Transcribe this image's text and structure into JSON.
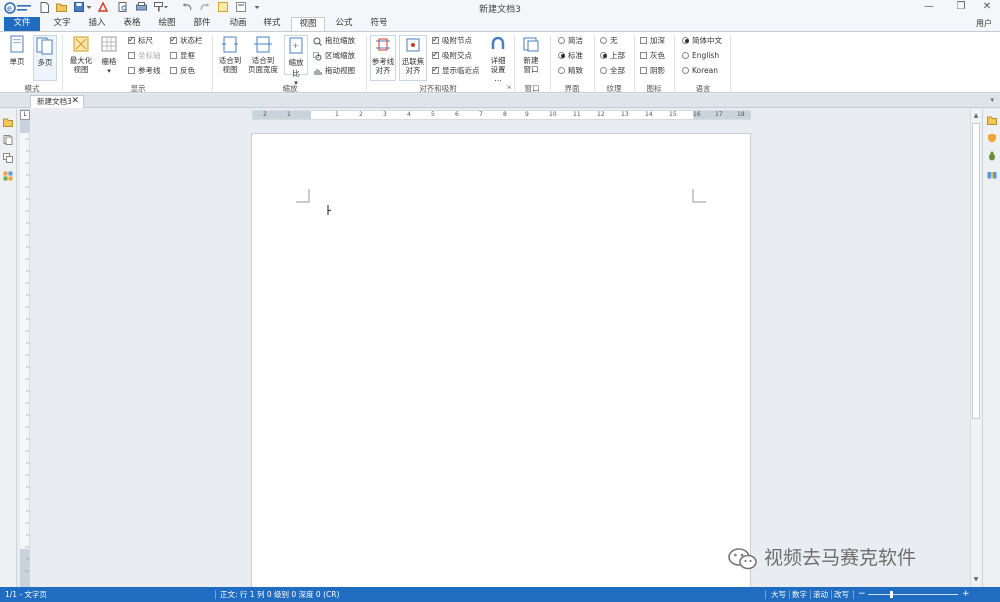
{
  "window": {
    "title": "新建文档3",
    "user_label": "用户",
    "minimize_glyph": "—",
    "maximize_glyph": "❐",
    "close_glyph": "✕"
  },
  "tabs": [
    {
      "label": "文件"
    },
    {
      "label": "文字"
    },
    {
      "label": "插入"
    },
    {
      "label": "表格"
    },
    {
      "label": "绘图"
    },
    {
      "label": "部件"
    },
    {
      "label": "动画"
    },
    {
      "label": "样式"
    },
    {
      "label": "视图"
    },
    {
      "label": "公式"
    },
    {
      "label": "符号"
    }
  ],
  "active_tab": "视图",
  "ribbon": {
    "mode": {
      "label": "模式",
      "single_page": "单页",
      "multi_page": "多页"
    },
    "display": {
      "label": "显示",
      "maximize_view": "最大化\n视图",
      "grid": "栅格",
      "ruler": {
        "label": "标尺",
        "checked": true
      },
      "coords": {
        "label": "坐标轴",
        "checked": false,
        "disabled": true
      },
      "guides": {
        "label": "参考线",
        "checked": false
      },
      "statusbar": {
        "label": "状态栏",
        "checked": true
      },
      "picture_frame": {
        "label": "显框",
        "checked": false
      },
      "invert": {
        "label": "反色",
        "checked": false
      }
    },
    "zoom": {
      "label": "缩放",
      "fit_view": "适合到\n视图",
      "fit_page_width": "适合到\n页面宽度",
      "zoom_ratio": "缩放比",
      "drag_zoom": "拖拉缩放",
      "region_zoom": "区域缩放",
      "drag_view": "拖动视图"
    },
    "align": {
      "label": "对齐和吸附",
      "guide_align": "参考线\n对齐",
      "fast_align": "迅联焦\n对齐",
      "snap_node": {
        "label": "吸附节点",
        "checked": true
      },
      "snap_intersect": {
        "label": "吸附交点",
        "checked": true
      },
      "show_nearest": {
        "label": "显示临近点",
        "checked": true
      },
      "detail_settings": "详细\n设置\n..."
    },
    "window_group": {
      "label": "窗口",
      "new_window": "新建\n窗口"
    },
    "interface": {
      "label": "界面",
      "options": [
        {
          "label": "简洁",
          "selected": false
        },
        {
          "label": "标准",
          "selected": true
        },
        {
          "label": "精致",
          "selected": false
        }
      ]
    },
    "texture": {
      "label": "纹理",
      "options": [
        {
          "label": "无",
          "selected": false
        },
        {
          "label": "上部",
          "selected": true
        },
        {
          "label": "全部",
          "selected": false
        }
      ]
    },
    "icon_group": {
      "label": "图标",
      "options": [
        {
          "label": "加深",
          "checked": false
        },
        {
          "label": "灰色",
          "checked": false
        },
        {
          "label": "阴影",
          "checked": false
        }
      ]
    },
    "language": {
      "label": "语言",
      "options": [
        {
          "label": "简体中文",
          "selected": true
        },
        {
          "label": "English",
          "selected": false
        },
        {
          "label": "Korean",
          "selected": false
        }
      ]
    }
  },
  "document_tab": {
    "label": "新建文档3",
    "close_glyph": "✕"
  },
  "ruler_corner": "L",
  "ruler_numbers": [
    "2",
    "1",
    "1",
    "2",
    "3",
    "4",
    "5",
    "6",
    "7",
    "8",
    "9",
    "10",
    "11",
    "12",
    "13",
    "14",
    "15",
    "16",
    "17",
    "18"
  ],
  "watermark": "视频去马赛克软件",
  "statusbar": {
    "page": "1/1 - 文字页",
    "text_info": "正文: 行 1  列 0  级别 0  深度 0 (CR)",
    "caps": "大写",
    "num": "数字",
    "scroll": "滚动",
    "overwrite": "改写"
  }
}
